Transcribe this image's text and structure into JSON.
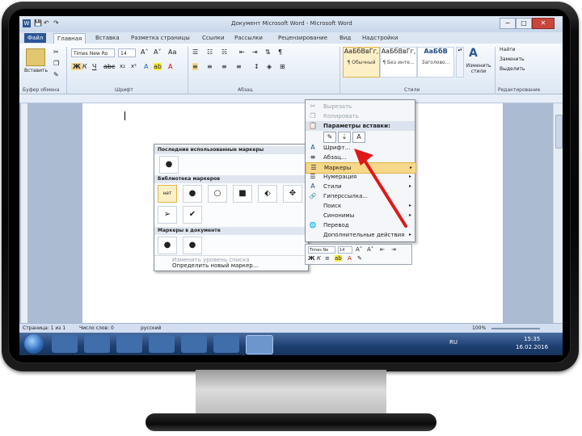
{
  "window": {
    "title": "Документ Microsoft Word - Microsoft Word",
    "minimize": "−",
    "maximize": "□",
    "close": "✕"
  },
  "ribbon_tabs": [
    "Файл",
    "Главная",
    "Вставка",
    "Разметка страницы",
    "Ссылки",
    "Рассылки",
    "Рецензирование",
    "Вид",
    "Надстройки"
  ],
  "ribbon": {
    "paste": "Вставить",
    "font_name": "Times New Ro",
    "font_size": "14",
    "groups": [
      "Буфер обмена",
      "Шрифт",
      "Абзац",
      "Стили",
      "Редактирование"
    ],
    "styles": [
      {
        "sample": "АаБбВвГг,",
        "name": "¶ Обычный"
      },
      {
        "sample": "АаБбВвГг,",
        "name": "¶ Без инте..."
      },
      {
        "sample": "АаБбВ",
        "name": "Заголово..."
      }
    ],
    "change_styles": "Изменить стили",
    "editing": [
      "Найти",
      "Заменить",
      "Выделить"
    ]
  },
  "context_menu": {
    "items": [
      {
        "label": "Вырезать",
        "icon": "scissors-icon",
        "glyph": "✂",
        "dim": true
      },
      {
        "label": "Копировать",
        "icon": "copy-icon",
        "glyph": "❐",
        "dim": true
      },
      {
        "label": "Параметры вставки:",
        "icon": "paste-icon",
        "glyph": "📋",
        "head": true
      },
      {
        "label": "Шрифт...",
        "icon": "font-icon",
        "glyph": "A"
      },
      {
        "label": "Абзац...",
        "icon": "paragraph-icon",
        "glyph": "≡"
      },
      {
        "label": "Маркеры",
        "icon": "bullets-icon",
        "glyph": "☰",
        "arrow": "▸"
      },
      {
        "label": "Нумерация",
        "icon": "numbering-icon",
        "glyph": "☰",
        "arrow": "▸"
      },
      {
        "label": "Стили",
        "icon": "styles-icon",
        "glyph": "A",
        "arrow": "▸"
      },
      {
        "label": "Гиперссылка...",
        "icon": "hyperlink-icon",
        "glyph": "🔗"
      },
      {
        "label": "Поиск",
        "icon": "search-icon",
        "glyph": "",
        "arrow": "▸"
      },
      {
        "label": "Синонимы",
        "icon": "synonyms-icon",
        "glyph": "",
        "arrow": "▸"
      },
      {
        "label": "Перевод",
        "icon": "translate-icon",
        "glyph": "🌐"
      },
      {
        "label": "Дополнительные действия",
        "icon": "actions-icon",
        "glyph": "",
        "arrow": "▸"
      }
    ],
    "paste_option_glyphs": [
      "✎",
      "⇣",
      "A"
    ]
  },
  "minibar": {
    "font_name": "Times Ne",
    "font_size": "14"
  },
  "bullet_submenu": {
    "recent_header": "Последние использованные маркеры",
    "recent": [
      "●"
    ],
    "library_header": "Библиотека маркеров",
    "library_row1": [
      "нет",
      "●",
      "○",
      "■",
      "⬖",
      "✥"
    ],
    "library_row2": [
      "➢",
      "✔"
    ],
    "document_header": "Маркеры в документе",
    "document": [
      "●",
      "●"
    ],
    "change_level": "Изменить уровень списка",
    "define_new": "Определить новый маркер..."
  },
  "statusbar": {
    "page": "Страница: 1 из 1",
    "words": "Число слов: 0",
    "lang": "русский",
    "zoom": "100%"
  },
  "taskbar": {
    "lang": "RU",
    "time": "15:35",
    "date": "16.02.2016"
  },
  "colors": {
    "ribbon_blue": "#2b5797",
    "highlight": "#f6d88a",
    "arrow_red": "#e01818"
  }
}
